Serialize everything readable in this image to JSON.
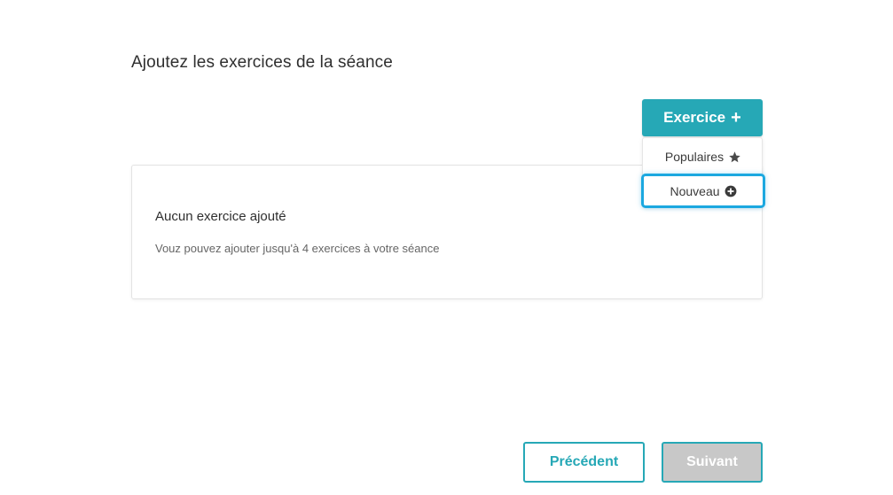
{
  "page": {
    "title": "Ajoutez les exercices de la séance"
  },
  "toolbar": {
    "add_exercise_label": "Exercice",
    "add_icon": "plus-icon"
  },
  "dropdown": {
    "items": [
      {
        "label": "Populaires",
        "icon": "star-icon"
      },
      {
        "label": "Nouveau",
        "icon": "plus-circle-icon"
      }
    ]
  },
  "empty_state": {
    "title": "Aucun exercice ajouté",
    "description": "Vouz pouvez ajouter jusqu'à 4 exercices à votre séance"
  },
  "footer": {
    "prev_label": "Précédent",
    "next_label": "Suivant"
  },
  "colors": {
    "accent": "#26a8b6",
    "highlight": "#1ba8e0",
    "disabled": "#c8c8c8"
  }
}
